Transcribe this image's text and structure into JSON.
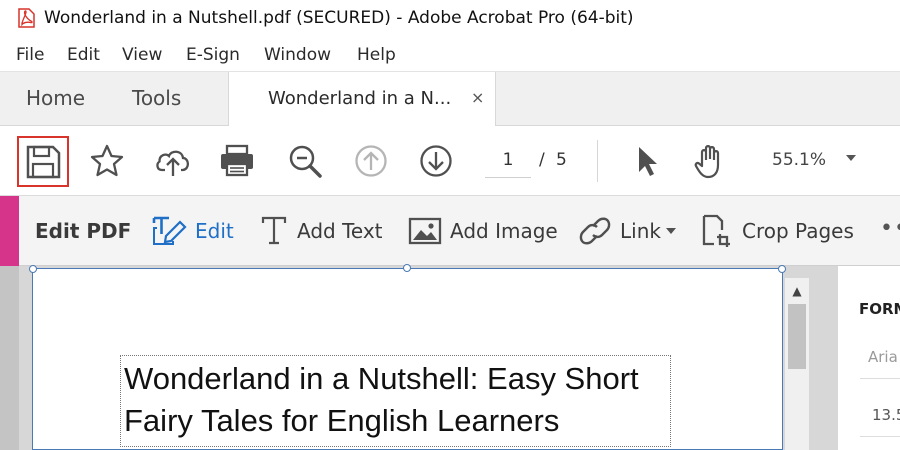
{
  "window": {
    "title": "Wonderland in a Nutshell.pdf (SECURED) - Adobe Acrobat Pro (64-bit)",
    "app_icon": "acrobat-pdf-icon"
  },
  "menu": [
    "File",
    "Edit",
    "View",
    "E-Sign",
    "Window",
    "Help"
  ],
  "tabs": {
    "home": "Home",
    "tools": "Tools",
    "document": "Wonderland in a N...",
    "close": "×"
  },
  "toolbar": {
    "icons": [
      "save-icon",
      "bookmark-star-icon",
      "cloud-upload-icon",
      "print-icon",
      "zoom-out-icon",
      "previous-page-icon",
      "next-page-icon",
      "select-pointer-icon",
      "hand-tool-icon"
    ],
    "page_current": "1",
    "page_separator": "/",
    "page_total": "5",
    "zoom": "55.1%",
    "highlight_color": "#d9342b"
  },
  "edit_bar": {
    "label": "Edit PDF",
    "edit": "Edit",
    "add_text": "Add Text",
    "add_image": "Add Image",
    "link": "Link",
    "crop_pages": "Crop Pages",
    "more": "••",
    "accent_color": "#d6338a",
    "active_color": "#1f6fc7"
  },
  "document": {
    "title_line1": "Wonderland in a Nutshell: Easy Short",
    "title_line2": "Fairy Tales for English Learners"
  },
  "format_panel": {
    "heading": "FORM",
    "font": "Aria",
    "size": "13.5"
  }
}
